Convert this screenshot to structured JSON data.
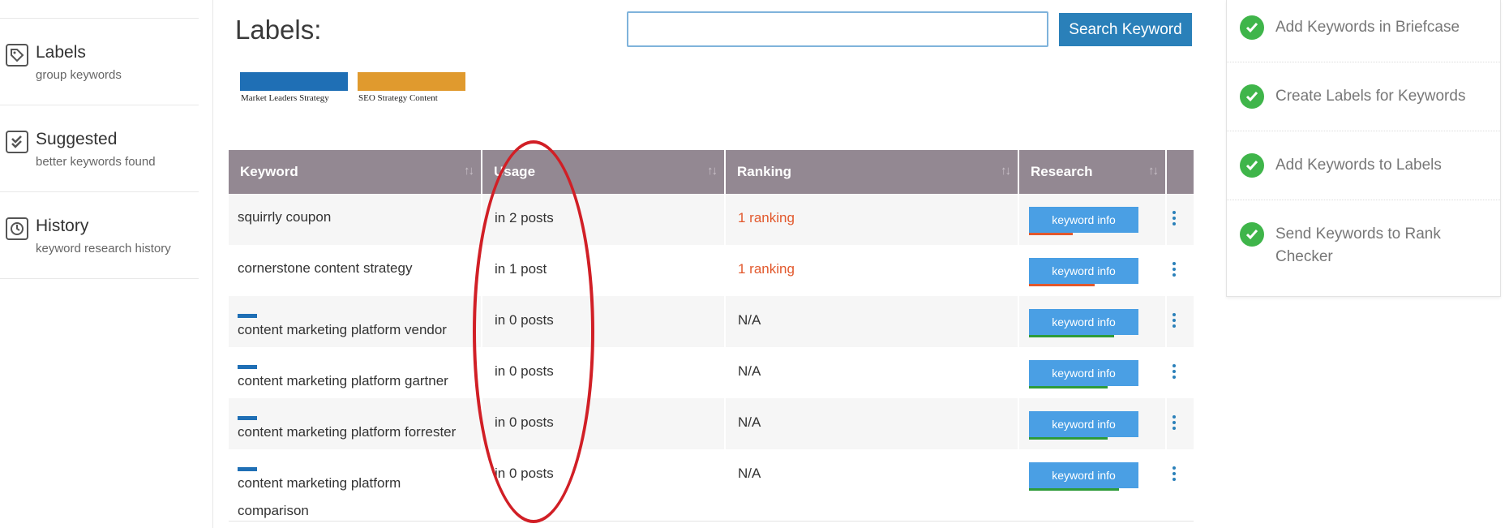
{
  "sidebar": {
    "items": [
      {
        "title": "Labels",
        "subtitle": "group keywords",
        "icon": "tag-icon"
      },
      {
        "title": "Suggested",
        "subtitle": "better keywords found",
        "icon": "check-shield-icon"
      },
      {
        "title": "History",
        "subtitle": "keyword research history",
        "icon": "clock-icon"
      }
    ]
  },
  "main": {
    "title": "Labels:",
    "search": {
      "value": "",
      "button_label": "Search Keyword"
    },
    "labels": [
      {
        "name": "Market Leaders Strategy",
        "color": "#1f6fb5"
      },
      {
        "name": "SEO Strategy Content",
        "color": "#e09a2e"
      }
    ]
  },
  "table": {
    "columns": [
      {
        "label": "Keyword",
        "sort": "↑↓"
      },
      {
        "label": "Usage",
        "sort": "↑↓"
      },
      {
        "label": "Ranking",
        "sort": "↑↓"
      },
      {
        "label": "Research",
        "sort": "↑↓"
      }
    ],
    "rows": [
      {
        "keyword": [
          "squirrly coupon"
        ],
        "usage": "in 2 posts",
        "ranking": "1 ranking",
        "ranking_linked": true,
        "button": "keyword info",
        "has_label": false,
        "bar_color": "#e2582c",
        "bar_fraction": 0.4
      },
      {
        "keyword": [
          "cornerstone content strategy"
        ],
        "usage": "in 1 post",
        "ranking": "1 ranking",
        "ranking_linked": true,
        "button": "keyword info",
        "has_label": false,
        "bar_color": "#e2582c",
        "bar_fraction": 0.6
      },
      {
        "keyword": [
          "content marketing platform vendor"
        ],
        "usage": "in 0 posts",
        "ranking": "N/A",
        "ranking_linked": false,
        "button": "keyword info",
        "has_label": true,
        "bar_color": "#2e9b3a",
        "bar_fraction": 0.78
      },
      {
        "keyword": [
          "content marketing platform gartner"
        ],
        "usage": "in 0 posts",
        "ranking": "N/A",
        "ranking_linked": false,
        "button": "keyword info",
        "has_label": true,
        "bar_color": "#2e9b3a",
        "bar_fraction": 0.72
      },
      {
        "keyword": [
          "content marketing platform forrester"
        ],
        "usage": "in 0 posts",
        "ranking": "N/A",
        "ranking_linked": false,
        "button": "keyword info",
        "has_label": true,
        "bar_color": "#2e9b3a",
        "bar_fraction": 0.72
      },
      {
        "keyword": [
          "content marketing platform",
          "comparison"
        ],
        "usage": "in 0 posts",
        "ranking": "N/A",
        "ranking_linked": false,
        "button": "keyword info",
        "has_label": true,
        "bar_color": "#2e9b3a",
        "bar_fraction": 0.82
      }
    ]
  },
  "checklist": {
    "items": [
      {
        "lines": [
          "Add Keywords in Briefcase"
        ]
      },
      {
        "lines": [
          "Create Labels for Keywords"
        ]
      },
      {
        "lines": [
          "Add Keywords to Labels"
        ]
      },
      {
        "lines": [
          "Send Keywords to Rank",
          "Checker"
        ]
      }
    ]
  }
}
